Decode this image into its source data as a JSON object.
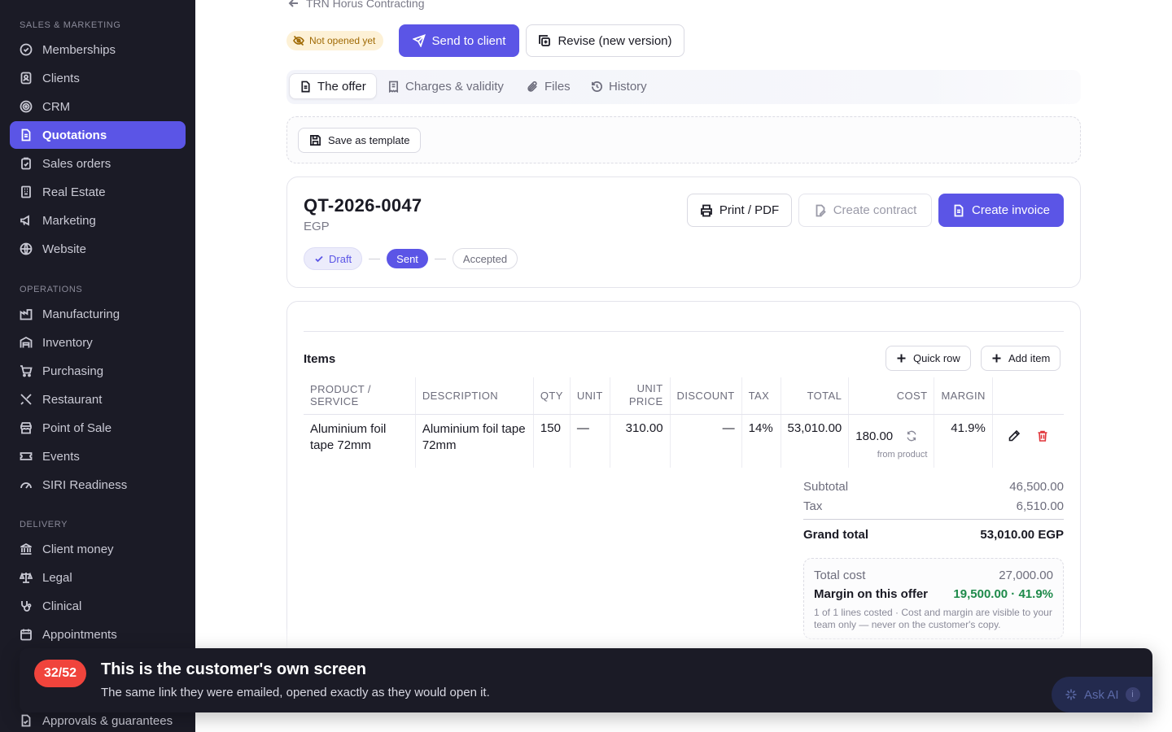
{
  "sidebar": {
    "sections": [
      {
        "title": "SALES & MARKETING",
        "items": [
          {
            "label": "Memberships",
            "icon": "badge-check-icon"
          },
          {
            "label": "Clients",
            "icon": "contact-icon"
          },
          {
            "label": "CRM",
            "icon": "target-icon"
          },
          {
            "label": "Quotations",
            "icon": "document-icon",
            "active": true
          },
          {
            "label": "Sales orders",
            "icon": "clipboard-icon"
          },
          {
            "label": "Real Estate",
            "icon": "building-icon"
          },
          {
            "label": "Marketing",
            "icon": "megaphone-icon"
          },
          {
            "label": "Website",
            "icon": "globe-icon"
          }
        ]
      },
      {
        "title": "OPERATIONS",
        "items": [
          {
            "label": "Manufacturing",
            "icon": "factory-icon"
          },
          {
            "label": "Inventory",
            "icon": "warehouse-icon"
          },
          {
            "label": "Purchasing",
            "icon": "cart-icon"
          },
          {
            "label": "Restaurant",
            "icon": "utensils-icon"
          },
          {
            "label": "Point of Sale",
            "icon": "store-icon"
          },
          {
            "label": "Events",
            "icon": "ticket-icon"
          },
          {
            "label": "SIRI Readiness",
            "icon": "gauge-icon"
          }
        ]
      },
      {
        "title": "DELIVERY",
        "items": [
          {
            "label": "Client money",
            "icon": "bank-icon"
          },
          {
            "label": "Legal",
            "icon": "scale-icon"
          },
          {
            "label": "Clinical",
            "icon": "stethoscope-icon"
          },
          {
            "label": "Appointments",
            "icon": "calendar-icon"
          },
          {
            "label": "Approvals & guarantees",
            "icon": "file-check-icon"
          }
        ]
      }
    ]
  },
  "header": {
    "breadcrumb": "TRN Horus Contracting",
    "status": "Not opened yet",
    "send_label": "Send to client",
    "revise_label": "Revise (new version)"
  },
  "tabs": [
    {
      "label": "The offer",
      "active": true
    },
    {
      "label": "Charges & validity"
    },
    {
      "label": "Files"
    },
    {
      "label": "History"
    }
  ],
  "template": {
    "save_label": "Save as template"
  },
  "quote": {
    "id": "QT-2026-0047",
    "currency": "EGP",
    "print_label": "Print / PDF",
    "contract_label": "Create contract",
    "invoice_label": "Create invoice",
    "steps": {
      "draft": "Draft",
      "sent": "Sent",
      "accepted": "Accepted"
    }
  },
  "items": {
    "title": "Items",
    "quick_row_label": "Quick row",
    "add_item_label": "Add item",
    "columns": {
      "product": "PRODUCT / SERVICE",
      "description": "DESCRIPTION",
      "qty": "QTY",
      "unit": "UNIT",
      "unit_price": "UNIT PRICE",
      "discount": "DISCOUNT",
      "tax": "TAX",
      "total": "TOTAL",
      "cost": "COST",
      "margin": "MARGIN"
    },
    "rows": [
      {
        "product": "Aluminium foil tape 72mm",
        "description": "Aluminium foil tape 72mm",
        "qty": "150",
        "unit": "—",
        "unit_price": "310.00",
        "discount": "—",
        "tax": "14%",
        "total": "53,010.00",
        "cost": "180.00",
        "cost_source": "from product",
        "margin": "41.9%"
      }
    ]
  },
  "totals": {
    "subtotal_label": "Subtotal",
    "subtotal": "46,500.00",
    "tax_label": "Tax",
    "tax": "6,510.00",
    "grand_label": "Grand total",
    "grand": "53,010.00 EGP",
    "cost_label": "Total cost",
    "cost": "27,000.00",
    "margin_label": "Margin on this offer",
    "margin": "19,500.00 · 41.9%",
    "note": "1 of 1 lines costed · Cost and margin are visible to your team only — never on the customer's copy."
  },
  "tour": {
    "step": "32/52",
    "title": "This is the customer's own screen",
    "text": "The same link they were emailed, opened exactly as they would open it."
  },
  "assistant": {
    "label": "Ask AI",
    "badge": "i"
  },
  "colors": {
    "accent": "#5b55e6",
    "sidebar": "#1b1b26",
    "margin": "#1e8a4a",
    "badge": "#f0443c",
    "status": "#fdf1d6"
  }
}
